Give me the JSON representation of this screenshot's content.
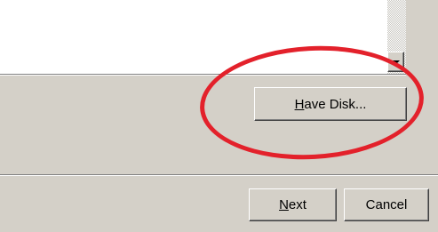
{
  "upper_panel": {
    "scrollbar": {
      "down_arrow": "chevron-down-icon"
    }
  },
  "have_disk_button": {
    "accel": "H",
    "rest": "ave Disk..."
  },
  "footer": {
    "next_button": {
      "accel": "N",
      "rest": "ext"
    },
    "cancel_button": {
      "label": "Cancel"
    }
  },
  "annotation": {
    "shape": "ellipse",
    "color": "#e3212b"
  }
}
